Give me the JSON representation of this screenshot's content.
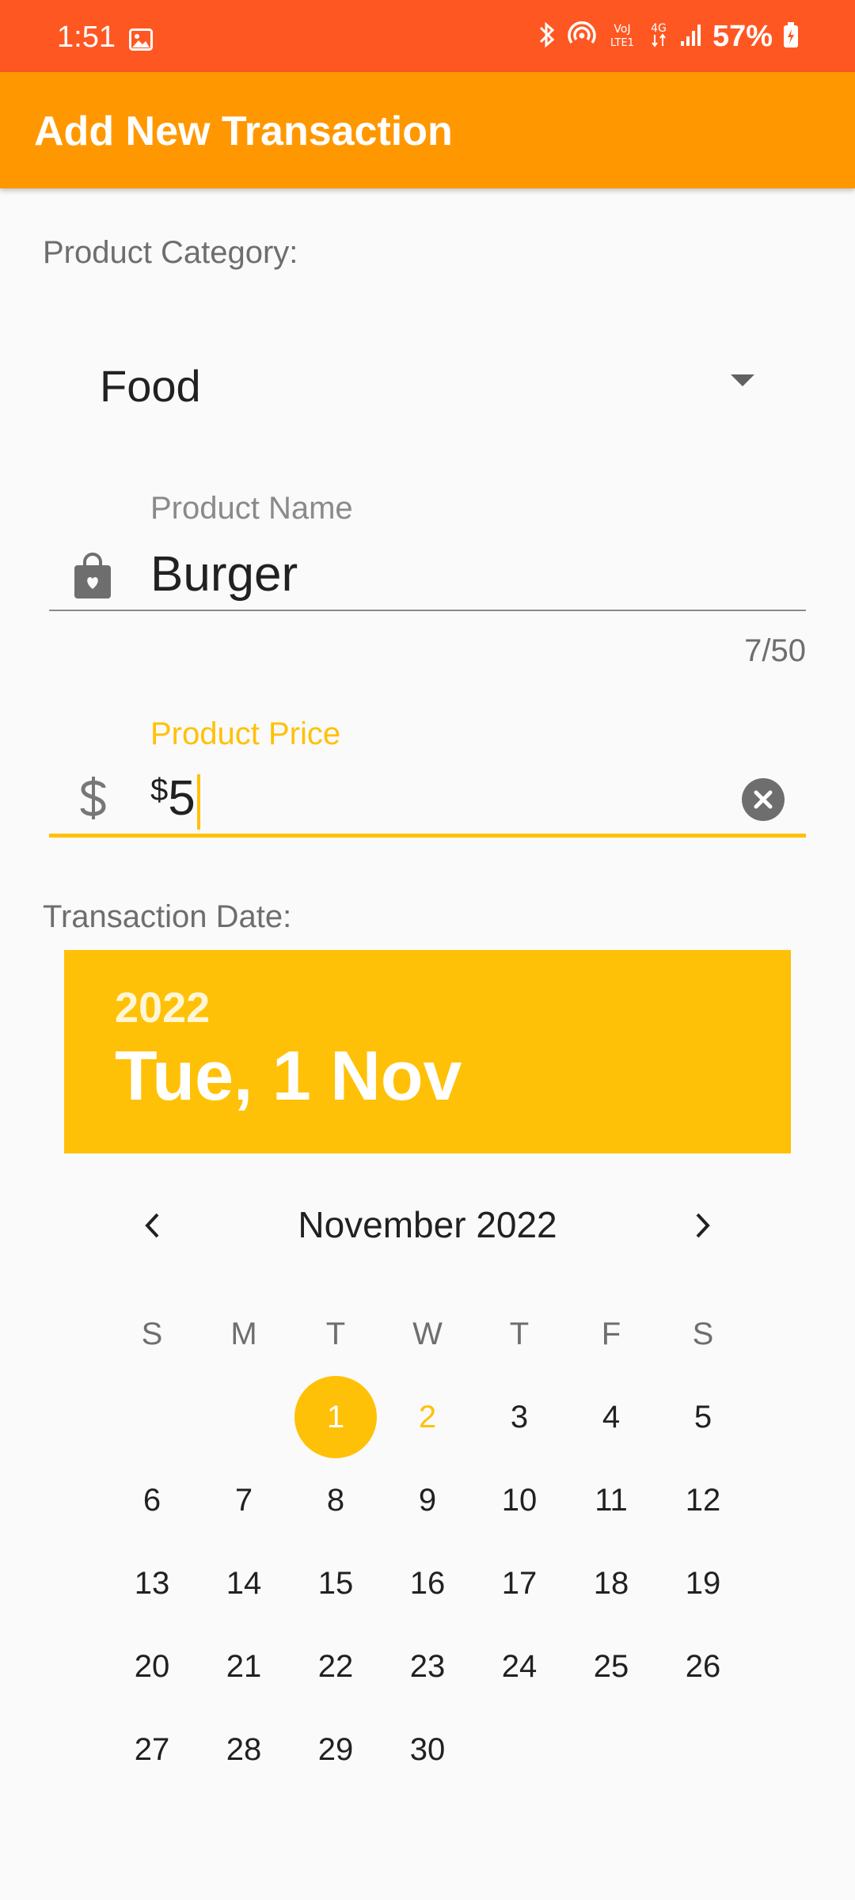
{
  "status_bar": {
    "time": "1:51",
    "battery": "57%",
    "icons": [
      "gallery-icon",
      "bluetooth-icon",
      "hotspot-icon",
      "volte-icon",
      "4g-data-icon",
      "signal-icon",
      "battery-charging-icon"
    ]
  },
  "app_bar": {
    "title": "Add New Transaction"
  },
  "category": {
    "label": "Product Category:",
    "selected": "Food"
  },
  "product_name": {
    "label": "Product Name",
    "value": "Burger",
    "counter": "7/50",
    "icon": "shopping-bag-icon"
  },
  "product_price": {
    "label": "Product Price",
    "prefix": "$",
    "value": "5",
    "icon": "dollar-icon"
  },
  "date": {
    "label": "Transaction Date:",
    "year": "2022",
    "full": "Tue, 1 Nov",
    "month_title": "November 2022",
    "weekdays": [
      "S",
      "M",
      "T",
      "W",
      "T",
      "F",
      "S"
    ],
    "weeks": [
      [
        "",
        "",
        "1",
        "2",
        "3",
        "4",
        "5"
      ],
      [
        "6",
        "7",
        "8",
        "9",
        "10",
        "11",
        "12"
      ],
      [
        "13",
        "14",
        "15",
        "16",
        "17",
        "18",
        "19"
      ],
      [
        "20",
        "21",
        "22",
        "23",
        "24",
        "25",
        "26"
      ],
      [
        "27",
        "28",
        "29",
        "30",
        "",
        "",
        ""
      ]
    ],
    "selected_day": "1",
    "today_day": "2"
  },
  "colors": {
    "status_bar": "#ff5722",
    "app_bar": "#ff9800",
    "accent": "#ffc107"
  }
}
